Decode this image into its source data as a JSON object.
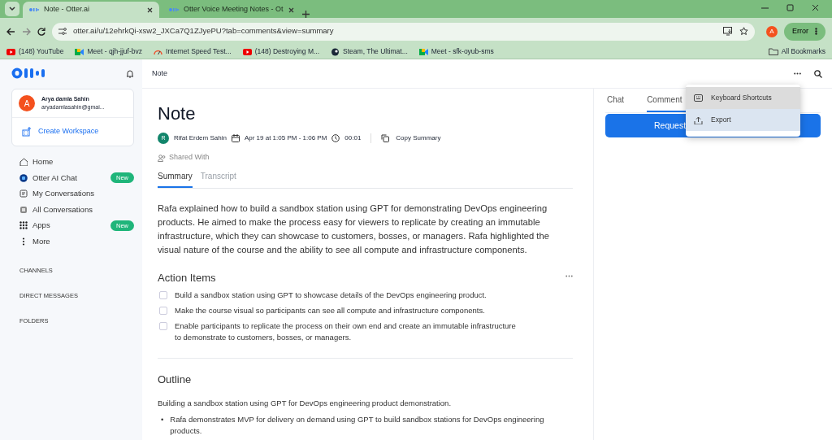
{
  "browser": {
    "tabs": [
      {
        "title": "Note - Otter.ai",
        "selected": true
      },
      {
        "title": "Otter Voice Meeting Notes - Ot",
        "selected": false
      }
    ],
    "url": "otter.ai/u/12ehrkQi-xsw2_JXCa7Q1ZJyePU?tab=comments&view=summary",
    "profile_initial": "A",
    "error_label": "Error",
    "bookmarks": [
      {
        "title": "(148) YouTube",
        "kind": "youtube"
      },
      {
        "title": "Meet - qjh-jjuf-bvz",
        "kind": "meet"
      },
      {
        "title": "Internet Speed Test...",
        "kind": "speed"
      },
      {
        "title": "(148) Destroying M...",
        "kind": "youtube"
      },
      {
        "title": "Steam, The Ultimat...",
        "kind": "steam"
      },
      {
        "title": "Meet - sfk-oyub-sms",
        "kind": "meet"
      }
    ],
    "all_bookmarks": "All Bookmarks"
  },
  "sidebar": {
    "user": {
      "initial": "A",
      "name": "Arya damla Sahin",
      "email": "aryadamlasahin@gmai..."
    },
    "create_workspace": "Create Workspace",
    "items": [
      {
        "label": "Home"
      },
      {
        "label": "Otter AI Chat",
        "badge": "New"
      },
      {
        "label": "My Conversations"
      },
      {
        "label": "All Conversations"
      },
      {
        "label": "Apps",
        "badge": "New"
      },
      {
        "label": "More"
      }
    ],
    "sections": [
      "CHANNELS",
      "DIRECT MESSAGES",
      "FOLDERS"
    ]
  },
  "header": {
    "title": "Note"
  },
  "note": {
    "title": "Note",
    "author_initial": "R",
    "author": "Rifat Erdem Sahin",
    "date": "Apr 19 at 1:05 PM - 1:06 PM",
    "duration": "00:01",
    "copy": "Copy Summary",
    "shared": "Shared With",
    "tabs": [
      {
        "label": "Summary",
        "selected": true
      },
      {
        "label": "Transcript",
        "selected": false
      }
    ],
    "summary": "Rafa explained how to build a sandbox station using GPT for demonstrating DevOps engineering products. He aimed to make the process easy for viewers to replicate by creating an immutable infrastructure, which they can showcase to customers, bosses, or managers. Rafa highlighted the visual nature of the course and the ability to see all compute and infrastructure components.",
    "action_items_title": "Action Items",
    "action_items": [
      {
        "text": "Build a sandbox station using GPT to showcase details of the DevOps engineering product.",
        "checked": false
      },
      {
        "text": "Make the course visual so participants can see all compute and infrastructure components.",
        "checked": false
      },
      {
        "text": "Enable participants to replicate the process on their own end and create an immutable infrastructure to demonstrate to customers, bosses, or managers.",
        "checked": false
      }
    ],
    "outline_title": "Outline",
    "outline_intro": "Building a sandbox station using GPT for DevOps engineering product demonstration.",
    "outline_points": [
      {
        "marker": "•",
        "text": "Rafa demonstrates MVP for delivery on demand using GPT to build sandbox stations for DevOps engineering products."
      }
    ]
  },
  "right_panel": {
    "tabs": [
      {
        "label": "Chat",
        "selected": false
      },
      {
        "label": "Comment",
        "selected": true
      }
    ],
    "button": "Request"
  },
  "menu": {
    "items": [
      {
        "label": "Keyboard Shortcuts",
        "hovered": true,
        "selected": false
      },
      {
        "label": "Export",
        "hovered": false,
        "selected": true
      }
    ]
  }
}
